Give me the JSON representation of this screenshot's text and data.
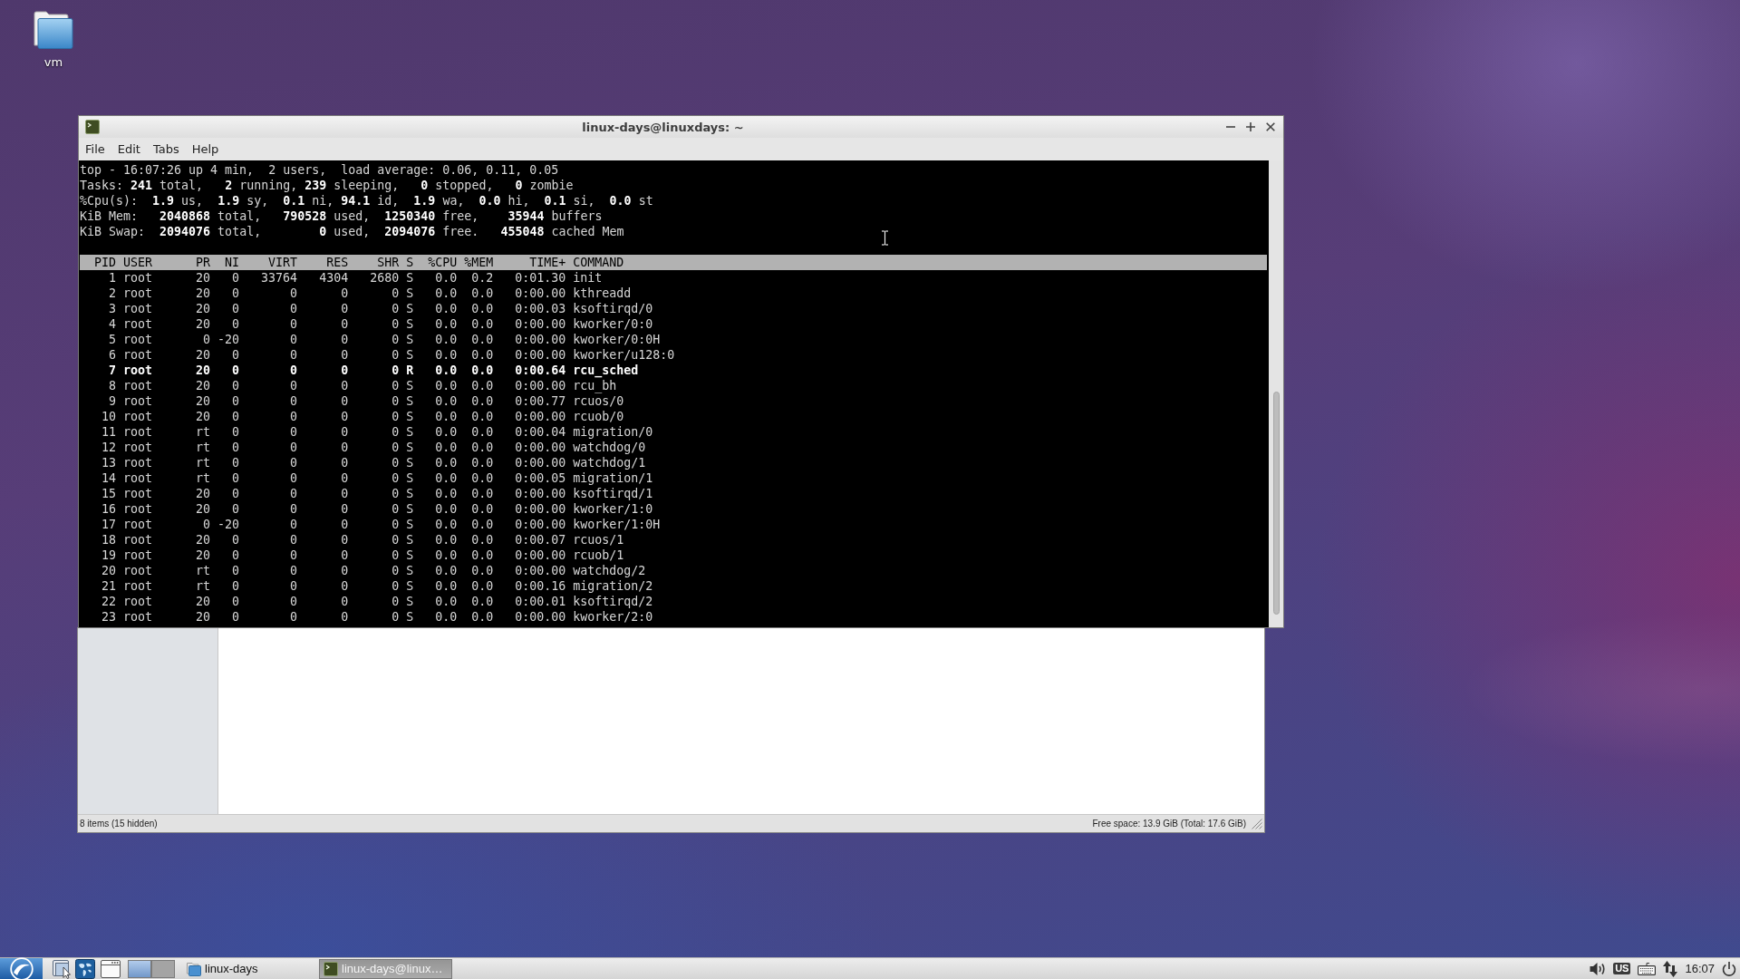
{
  "desktop": {
    "icons": [
      {
        "label": "vm"
      }
    ]
  },
  "terminal_window": {
    "title": "linux-days@linuxdays: ~",
    "menu": [
      "File",
      "Edit",
      "Tabs",
      "Help"
    ],
    "summary_lines": [
      "top - 16:07:26 up 4 min,  2 users,  load average: 0.06, 0.11, 0.05",
      "Tasks: **241** total,   **2** running, **239** sleeping,   **0** stopped,   **0** zombie",
      "%Cpu(s):  **1.9** us,  **1.9** sy,  **0.1** ni, **94.1** id,  **1.9** wa,  **0.0** hi,  **0.1** si,  **0.0** st",
      "KiB Mem:   **2040868** total,   **790528** used,  **1250340** free,    **35944** buffers",
      "KiB Swap:  **2094076** total,        **0** used,  **2094076** free.   **455048** cached Mem"
    ],
    "process_table": {
      "columns": [
        "PID",
        "USER",
        "PR",
        "NI",
        "VIRT",
        "RES",
        "SHR",
        "S",
        "%CPU",
        "%MEM",
        "TIME+",
        "COMMAND"
      ],
      "rows": [
        {
          "cells": [
            "1",
            "root",
            "20",
            "0",
            "33764",
            "4304",
            "2680",
            "S",
            "0.0",
            "0.2",
            "0:01.30",
            "init"
          ],
          "highlighted": false
        },
        {
          "cells": [
            "2",
            "root",
            "20",
            "0",
            "0",
            "0",
            "0",
            "S",
            "0.0",
            "0.0",
            "0:00.00",
            "kthreadd"
          ],
          "highlighted": false
        },
        {
          "cells": [
            "3",
            "root",
            "20",
            "0",
            "0",
            "0",
            "0",
            "S",
            "0.0",
            "0.0",
            "0:00.03",
            "ksoftirqd/0"
          ],
          "highlighted": false
        },
        {
          "cells": [
            "4",
            "root",
            "20",
            "0",
            "0",
            "0",
            "0",
            "S",
            "0.0",
            "0.0",
            "0:00.00",
            "kworker/0:0"
          ],
          "highlighted": false
        },
        {
          "cells": [
            "5",
            "root",
            "0",
            "-20",
            "0",
            "0",
            "0",
            "S",
            "0.0",
            "0.0",
            "0:00.00",
            "kworker/0:0H"
          ],
          "highlighted": false
        },
        {
          "cells": [
            "6",
            "root",
            "20",
            "0",
            "0",
            "0",
            "0",
            "S",
            "0.0",
            "0.0",
            "0:00.00",
            "kworker/u128:0"
          ],
          "highlighted": false
        },
        {
          "cells": [
            "7",
            "root",
            "20",
            "0",
            "0",
            "0",
            "0",
            "R",
            "0.0",
            "0.0",
            "0:00.64",
            "rcu_sched"
          ],
          "highlighted": true
        },
        {
          "cells": [
            "8",
            "root",
            "20",
            "0",
            "0",
            "0",
            "0",
            "S",
            "0.0",
            "0.0",
            "0:00.00",
            "rcu_bh"
          ],
          "highlighted": false
        },
        {
          "cells": [
            "9",
            "root",
            "20",
            "0",
            "0",
            "0",
            "0",
            "S",
            "0.0",
            "0.0",
            "0:00.77",
            "rcuos/0"
          ],
          "highlighted": false
        },
        {
          "cells": [
            "10",
            "root",
            "20",
            "0",
            "0",
            "0",
            "0",
            "S",
            "0.0",
            "0.0",
            "0:00.00",
            "rcuob/0"
          ],
          "highlighted": false
        },
        {
          "cells": [
            "11",
            "root",
            "rt",
            "0",
            "0",
            "0",
            "0",
            "S",
            "0.0",
            "0.0",
            "0:00.04",
            "migration/0"
          ],
          "highlighted": false
        },
        {
          "cells": [
            "12",
            "root",
            "rt",
            "0",
            "0",
            "0",
            "0",
            "S",
            "0.0",
            "0.0",
            "0:00.00",
            "watchdog/0"
          ],
          "highlighted": false
        },
        {
          "cells": [
            "13",
            "root",
            "rt",
            "0",
            "0",
            "0",
            "0",
            "S",
            "0.0",
            "0.0",
            "0:00.00",
            "watchdog/1"
          ],
          "highlighted": false
        },
        {
          "cells": [
            "14",
            "root",
            "rt",
            "0",
            "0",
            "0",
            "0",
            "S",
            "0.0",
            "0.0",
            "0:00.05",
            "migration/1"
          ],
          "highlighted": false
        },
        {
          "cells": [
            "15",
            "root",
            "20",
            "0",
            "0",
            "0",
            "0",
            "S",
            "0.0",
            "0.0",
            "0:00.00",
            "ksoftirqd/1"
          ],
          "highlighted": false
        },
        {
          "cells": [
            "16",
            "root",
            "20",
            "0",
            "0",
            "0",
            "0",
            "S",
            "0.0",
            "0.0",
            "0:00.00",
            "kworker/1:0"
          ],
          "highlighted": false
        },
        {
          "cells": [
            "17",
            "root",
            "0",
            "-20",
            "0",
            "0",
            "0",
            "S",
            "0.0",
            "0.0",
            "0:00.00",
            "kworker/1:0H"
          ],
          "highlighted": false
        },
        {
          "cells": [
            "18",
            "root",
            "20",
            "0",
            "0",
            "0",
            "0",
            "S",
            "0.0",
            "0.0",
            "0:00.07",
            "rcuos/1"
          ],
          "highlighted": false
        },
        {
          "cells": [
            "19",
            "root",
            "20",
            "0",
            "0",
            "0",
            "0",
            "S",
            "0.0",
            "0.0",
            "0:00.00",
            "rcuob/1"
          ],
          "highlighted": false
        },
        {
          "cells": [
            "20",
            "root",
            "rt",
            "0",
            "0",
            "0",
            "0",
            "S",
            "0.0",
            "0.0",
            "0:00.00",
            "watchdog/2"
          ],
          "highlighted": false
        },
        {
          "cells": [
            "21",
            "root",
            "rt",
            "0",
            "0",
            "0",
            "0",
            "S",
            "0.0",
            "0.0",
            "0:00.16",
            "migration/2"
          ],
          "highlighted": false
        },
        {
          "cells": [
            "22",
            "root",
            "20",
            "0",
            "0",
            "0",
            "0",
            "S",
            "0.0",
            "0.0",
            "0:00.01",
            "ksoftirqd/2"
          ],
          "highlighted": false
        },
        {
          "cells": [
            "23",
            "root",
            "20",
            "0",
            "0",
            "0",
            "0",
            "S",
            "0.0",
            "0.0",
            "0:00.00",
            "kworker/2:0"
          ],
          "highlighted": false
        }
      ]
    }
  },
  "file_manager_window": {
    "status_bar": {
      "item_count": "8 items (15 hidden)",
      "free_space": "Free space: 13.9 GiB (Total: 17.6 GiB)"
    }
  },
  "taskbar": {
    "workspaces": [
      {
        "selected": true
      },
      {
        "selected": false
      }
    ],
    "tasks": [
      {
        "label": "linux-days",
        "kind": "folder",
        "selected": false
      },
      {
        "label": "linux-days@linux…",
        "kind": "terminal",
        "selected": true
      }
    ],
    "keyboard_layout": "US",
    "clock": "16:07"
  }
}
